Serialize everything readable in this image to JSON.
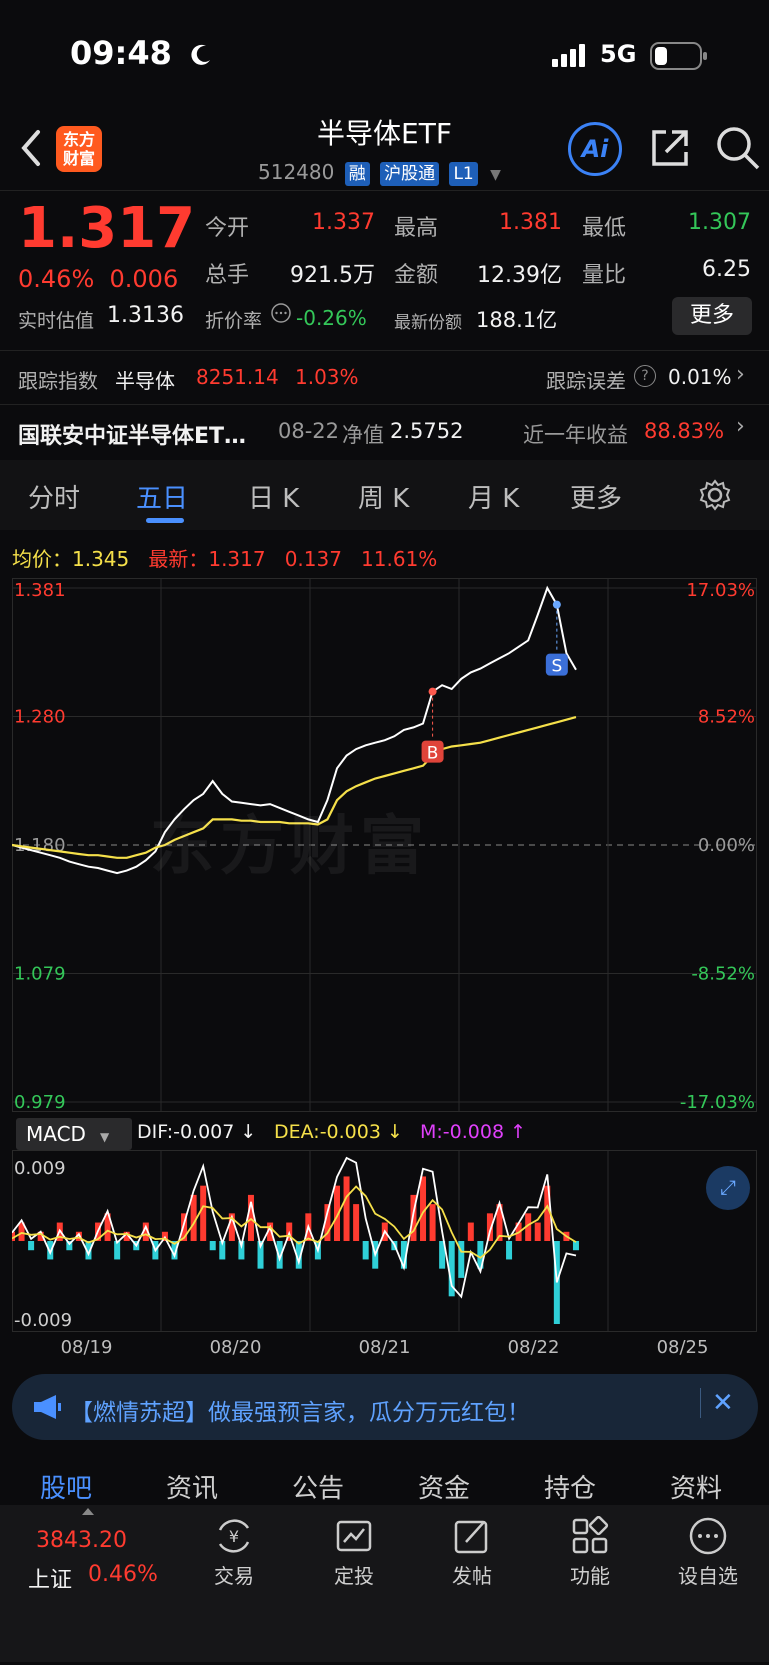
{
  "status": {
    "time": "09:48",
    "network": "5G"
  },
  "header": {
    "logo_text_line1": "东方",
    "logo_text_line2": "财富",
    "title": "半导体ETF",
    "code": "512480",
    "tags": [
      "融",
      "沪股通",
      "L1"
    ],
    "ai_label": "Ai"
  },
  "quote": {
    "price": "1.317",
    "change_pct": "0.46%",
    "change_abs": "0.006",
    "open_label": "今开",
    "open": "1.337",
    "high_label": "最高",
    "high": "1.381",
    "low_label": "最低",
    "low": "1.307",
    "volume_label": "总手",
    "volume": "921.5万",
    "amount_label": "金额",
    "amount": "12.39亿",
    "ratio_label": "量比",
    "ratio": "6.25",
    "iopv_label": "实时估值",
    "iopv": "1.3136",
    "discount_label": "折价率",
    "discount": "-0.26%",
    "shares_label": "最新份额",
    "shares": "188.1亿",
    "more_label": "更多"
  },
  "tracking": {
    "index_label": "跟踪指数",
    "index_name": "半导体",
    "index_value": "8251.14",
    "index_pct": "1.03%",
    "error_label": "跟踪误差",
    "error_value": "0.01%"
  },
  "fund": {
    "name": "国联安中证半导体ET…",
    "nav_date": "08-22",
    "nav_label": "净值",
    "nav": "2.5752",
    "return_label": "近一年收益",
    "return_value": "88.83%"
  },
  "tabs": [
    "分时",
    "五日",
    "日 K",
    "周 K",
    "月 K",
    "更多"
  ],
  "active_tab": "五日",
  "chart_header": {
    "avg_label": "均价：",
    "avg_value": "1.345",
    "latest_label": "最新：",
    "latest_value": "1.317",
    "change": "0.137",
    "change_pct": "11.61%"
  },
  "chart_data": {
    "type": "line",
    "x_ticks": [
      "08/19",
      "08/20",
      "08/21",
      "08/22",
      "08/25"
    ],
    "y_left_ticks": [
      "1.381",
      "1.280",
      "1.180",
      "1.079",
      "0.979"
    ],
    "y_right_ticks": [
      "17.03%",
      "8.52%",
      "0.00%",
      "-8.52%",
      "-17.03%"
    ],
    "ylim": [
      0.979,
      1.381
    ],
    "base": 1.18,
    "series": [
      {
        "name": "最新",
        "color": "#ffffff",
        "values": [
          1.18,
          1.178,
          1.176,
          1.174,
          1.172,
          1.17,
          1.167,
          1.165,
          1.163,
          1.162,
          1.16,
          1.158,
          1.16,
          1.163,
          1.168,
          1.175,
          1.19,
          1.2,
          1.208,
          1.215,
          1.22,
          1.23,
          1.22,
          1.214,
          1.213,
          1.212,
          1.211,
          1.212,
          1.209,
          1.206,
          1.203,
          1.2,
          1.198,
          1.215,
          1.24,
          1.25,
          1.255,
          1.258,
          1.26,
          1.262,
          1.265,
          1.27,
          1.272,
          1.275,
          1.3,
          1.305,
          1.302,
          1.31,
          1.315,
          1.318,
          1.322,
          1.326,
          1.33,
          1.335,
          1.34,
          1.36,
          1.381,
          1.368,
          1.33,
          1.317
        ]
      },
      {
        "name": "均价",
        "color": "#f5e04a",
        "values": [
          1.18,
          1.179,
          1.178,
          1.177,
          1.176,
          1.175,
          1.174,
          1.173,
          1.172,
          1.172,
          1.171,
          1.17,
          1.17,
          1.172,
          1.174,
          1.178,
          1.18,
          1.184,
          1.187,
          1.19,
          1.193,
          1.2,
          1.2,
          1.2,
          1.199,
          1.199,
          1.198,
          1.198,
          1.198,
          1.197,
          1.197,
          1.197,
          1.196,
          1.2,
          1.215,
          1.222,
          1.226,
          1.229,
          1.232,
          1.234,
          1.236,
          1.238,
          1.24,
          1.242,
          1.25,
          1.255,
          1.257,
          1.258,
          1.259,
          1.26,
          1.262,
          1.264,
          1.266,
          1.268,
          1.27,
          1.272,
          1.274,
          1.276,
          1.278,
          1.28
        ]
      }
    ],
    "markers": [
      {
        "label": "B",
        "index": 44
      },
      {
        "label": "S",
        "index": 57
      }
    ]
  },
  "macd": {
    "label": "MACD",
    "dif_label": "DIF:-0.007 ↓",
    "dea_label": "DEA:-0.003 ↓",
    "m_label": "M:-0.008 ↑",
    "y_top": "0.009",
    "y_bottom": "-0.009",
    "ylim": [
      -0.009,
      0.009
    ],
    "hist": [
      0.001,
      0.002,
      -0.001,
      0.001,
      -0.002,
      0.002,
      -0.001,
      0.001,
      -0.002,
      0.002,
      0.003,
      -0.002,
      0.001,
      -0.001,
      0.002,
      -0.002,
      0.001,
      -0.002,
      0.003,
      0.005,
      0.006,
      -0.001,
      -0.002,
      0.003,
      -0.002,
      0.005,
      -0.003,
      0.002,
      -0.003,
      0.002,
      -0.003,
      0.003,
      -0.002,
      0.004,
      0.006,
      0.007,
      0.004,
      -0.002,
      -0.003,
      0.002,
      -0.001,
      -0.003,
      0.005,
      0.007,
      0.004,
      -0.003,
      -0.006,
      -0.004,
      0.002,
      -0.003,
      0.003,
      0.004,
      -0.002,
      0.002,
      0.003,
      0.002,
      0.006,
      -0.009,
      0.001,
      -0.001
    ]
  },
  "notice": {
    "text": "【燃情苏超】做最强预言家，瓜分万元红包！"
  },
  "bottom_tabs": [
    "股吧",
    "资讯",
    "公告",
    "资金",
    "持仓",
    "资料"
  ],
  "market": {
    "index_value": "3843.20",
    "index_name": "上证",
    "index_pct": "0.46%"
  },
  "nav": [
    "交易",
    "定投",
    "发帖",
    "功能",
    "设自选"
  ],
  "colors": {
    "up": "#ff3b30",
    "down": "#34c759",
    "accent": "#4a90ff",
    "avg": "#f5e04a"
  }
}
